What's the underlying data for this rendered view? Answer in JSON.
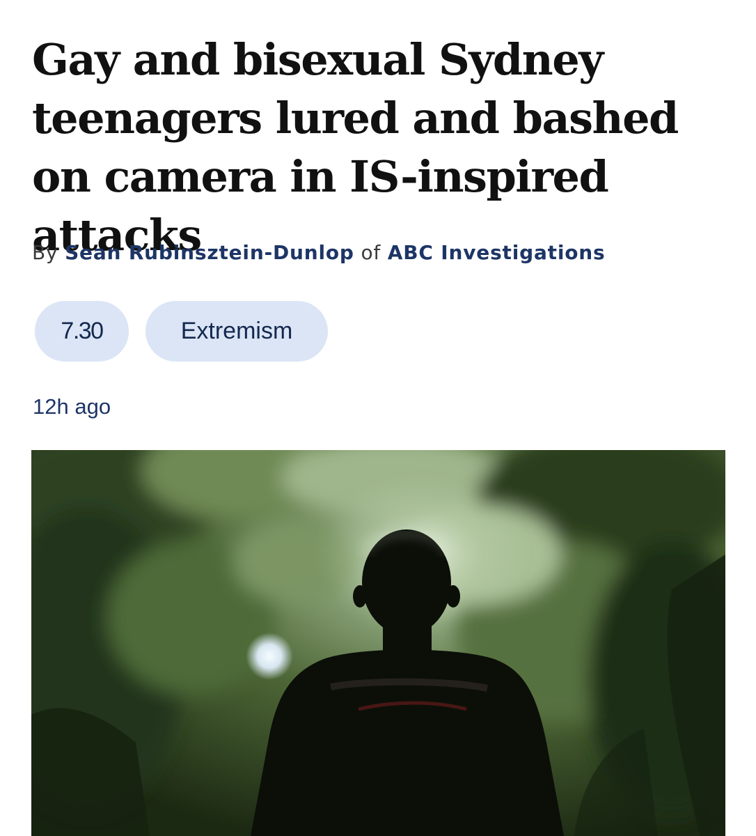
{
  "article": {
    "headline": "Gay and bisexual Sydney teenagers lured and bashed on camera in IS-inspired attacks",
    "byline": {
      "prefix": "By",
      "author": "Sean Rubinsztein-Dunlop",
      "joiner": "of",
      "organization": "ABC Investigations"
    },
    "tags": [
      {
        "label": "7.30"
      },
      {
        "label": "Extremism"
      }
    ],
    "timestamp": "12h ago"
  },
  "colors": {
    "headline": "#111111",
    "link": "#1d3566",
    "tag_background": "#dbe5f5",
    "tag_text": "#14284f"
  }
}
